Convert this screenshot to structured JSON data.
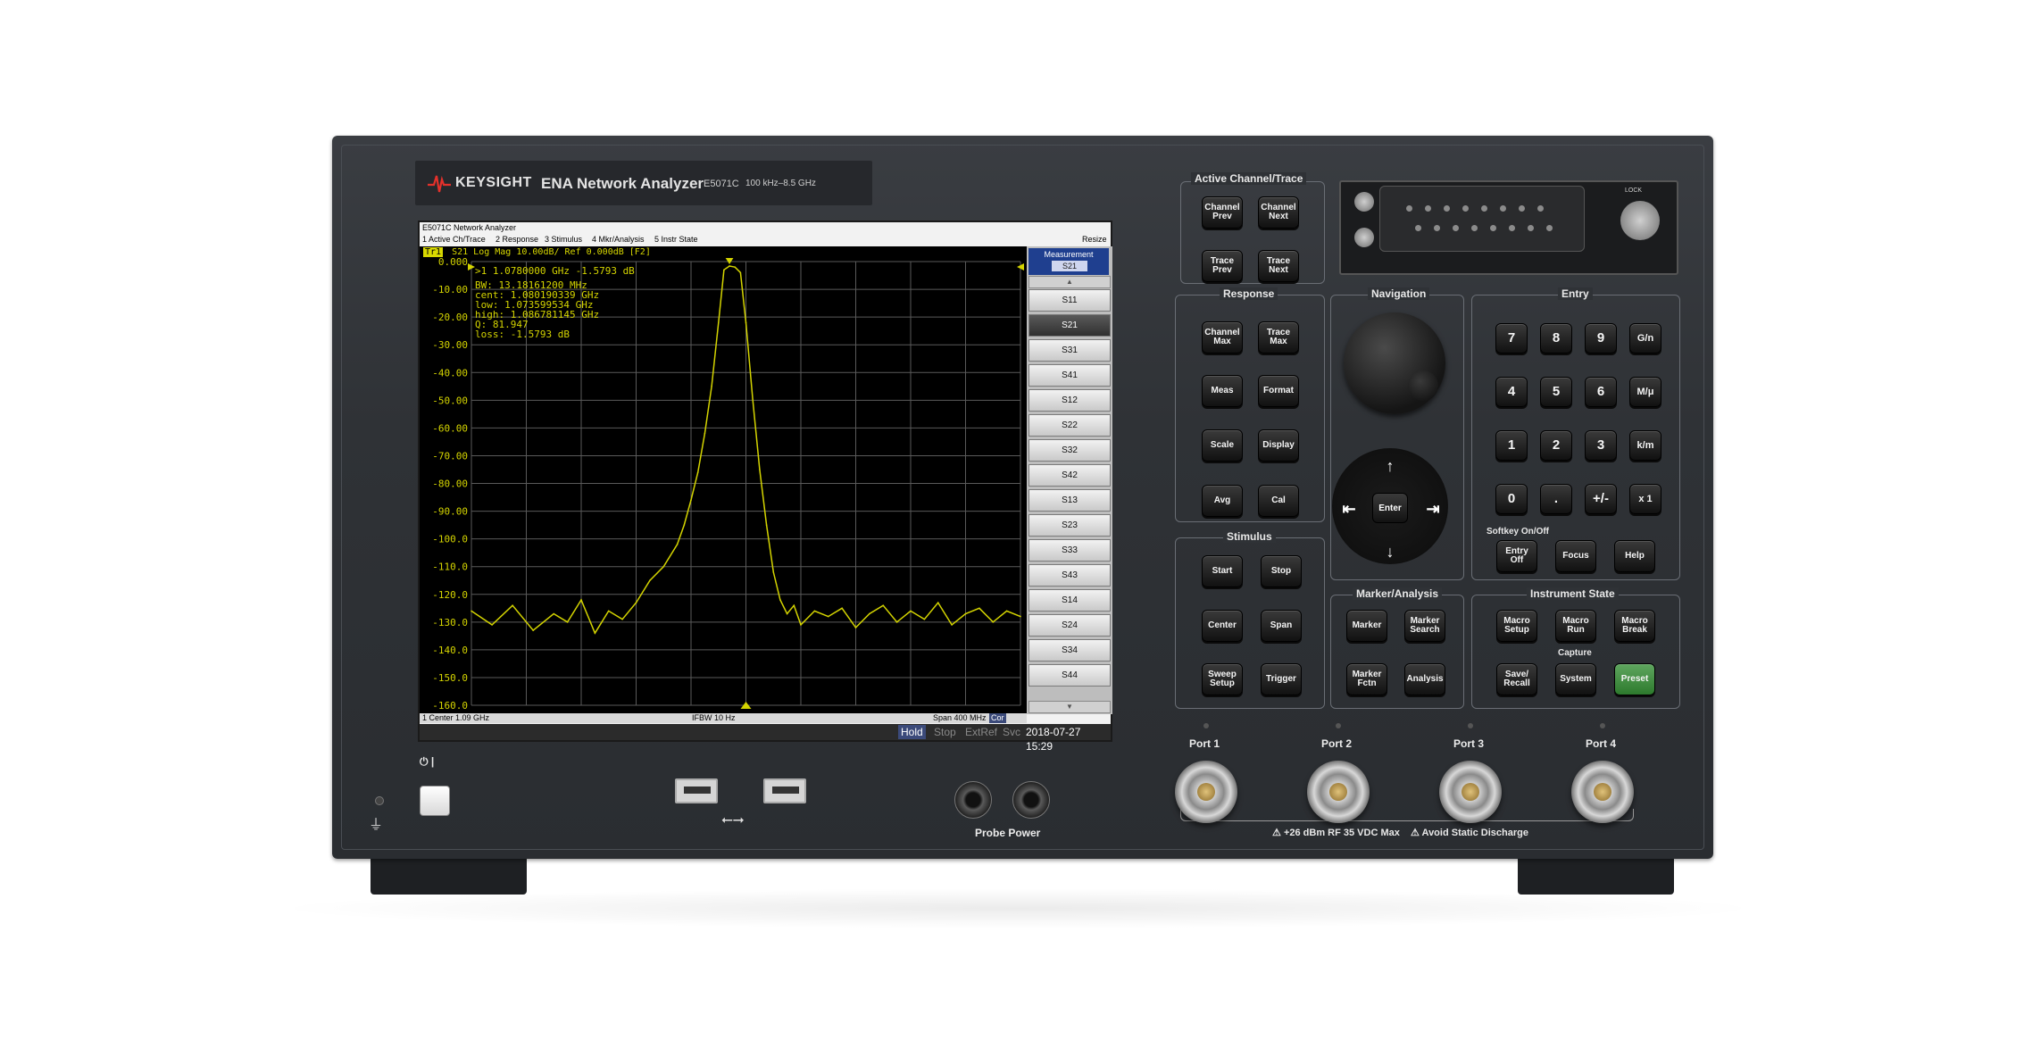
{
  "brand": {
    "name": "KEYSIGHT",
    "model_title": "ENA Network Analyzer",
    "model_number": "E5071C",
    "freq_range": "100 kHz–8.5 GHz"
  },
  "screen": {
    "window_title": "E5071C Network Analyzer",
    "menu": [
      "1 Active Ch/Trace",
      "2 Response",
      "3 Stimulus",
      "4 Mkr/Analysis",
      "5 Instr State"
    ],
    "resize_label": "Resize",
    "trace_badge": "Tr1",
    "trace_header": "S21 Log Mag 10.00dB/ Ref 0.000dB [F2]",
    "marker_readout": ">1  1.0780000 GHz -1.5793 dB",
    "bw_lines": [
      "  BW:  13.18161200 MHz",
      "cent:  1.080190339 GHz",
      " low:  1.073599534 GHz",
      "high:  1.086781145 GHz",
      "   Q:  81.947",
      "loss: -1.5793 dB"
    ],
    "bottom_left": "1  Center 1.09 GHz",
    "bottom_center": "IFBW 10 Hz",
    "bottom_right": "Span 400 MHz",
    "bottom_cor": "Cor",
    "status": {
      "hold": "Hold",
      "stop": "Stop",
      "extref": "ExtRef",
      "svc": "Svc",
      "datetime": "2018-07-27 15:29"
    },
    "softkeys": {
      "title": "Measurement",
      "current": "S21",
      "items": [
        "S11",
        "S21",
        "S31",
        "S41",
        "S12",
        "S22",
        "S32",
        "S42",
        "S13",
        "S23",
        "S33",
        "S43",
        "S14",
        "S24",
        "S34",
        "S44"
      ],
      "active_index": 1
    }
  },
  "chart_data": {
    "type": "line",
    "title": "",
    "xlabel": "",
    "ylabel": "",
    "xlim": [
      0.89,
      1.29
    ],
    "ylim": [
      -160,
      0
    ],
    "ytick_labels": [
      "0.000",
      "-10.00",
      "-20.00",
      "-30.00",
      "-40.00",
      "-50.00",
      "-60.00",
      "-70.00",
      "-80.00",
      "-90.00",
      "-100.0",
      "-110.0",
      "-120.0",
      "-130.0",
      "-140.0",
      "-150.0",
      "-160.0"
    ],
    "series": [
      {
        "x": [
          0.89,
          0.905,
          0.92,
          0.935,
          0.95,
          0.96,
          0.97,
          0.98,
          0.99,
          1.0,
          1.01,
          1.02,
          1.03,
          1.04,
          1.045,
          1.05,
          1.055,
          1.06,
          1.065,
          1.07,
          1.074,
          1.078,
          1.082,
          1.086,
          1.09,
          1.095,
          1.1,
          1.105,
          1.11,
          1.115,
          1.12,
          1.125,
          1.13,
          1.14,
          1.15,
          1.16,
          1.17,
          1.18,
          1.19,
          1.2,
          1.21,
          1.22,
          1.23,
          1.24,
          1.25,
          1.26,
          1.27,
          1.28,
          1.29
        ],
        "y": [
          -126,
          -131,
          -124,
          -133,
          -127,
          -130,
          -122,
          -134,
          -126,
          -129,
          -123,
          -115,
          -110,
          -102,
          -95,
          -86,
          -76,
          -62,
          -45,
          -22,
          -3,
          -1.6,
          -2,
          -4,
          -22,
          -50,
          -75,
          -95,
          -112,
          -122,
          -127,
          -124,
          -131,
          -126,
          -128,
          -125,
          -132,
          -127,
          -124,
          -130,
          -126,
          -129,
          -123,
          -131,
          -127,
          -125,
          -130,
          -126,
          -128
        ]
      }
    ]
  },
  "panel": {
    "active_channel_trace": {
      "label": "Active Channel/Trace",
      "keys": [
        "Channel Prev",
        "Channel Next",
        "Trace Prev",
        "Trace Next"
      ]
    },
    "response": {
      "label": "Response",
      "keys": [
        "Channel Max",
        "Trace Max",
        "Meas",
        "Format",
        "Scale",
        "Display",
        "Avg",
        "Cal"
      ]
    },
    "stimulus": {
      "label": "Stimulus",
      "keys": [
        "Start",
        "Stop",
        "Center",
        "Span",
        "Sweep Setup",
        "Trigger"
      ]
    },
    "navigation": {
      "label": "Navigation",
      "enter": "Enter",
      "arrows": [
        "↑",
        "↓",
        "⇤",
        "⇥"
      ]
    },
    "marker_analysis": {
      "label": "Marker/Analysis",
      "keys": [
        "Marker",
        "Marker Search",
        "Marker Fctn",
        "Analysis"
      ]
    },
    "entry": {
      "label": "Entry",
      "keys": [
        "7",
        "8",
        "9",
        "G/n",
        "4",
        "5",
        "6",
        "M/μ",
        "1",
        "2",
        "3",
        "k/m",
        "0",
        ".",
        "+/-",
        "x 1"
      ],
      "softkey_caption": "Softkey On/Off",
      "bottom_keys": [
        "Entry Off",
        "Focus",
        "Help"
      ]
    },
    "instrument_state": {
      "label": "Instrument State",
      "keys": [
        "Macro Setup",
        "Macro Run",
        "Macro Break"
      ],
      "capture_caption": "Capture",
      "bottom_keys": [
        "Save/ Recall",
        "System",
        "Preset"
      ]
    }
  },
  "ports": [
    "Port 1",
    "Port 2",
    "Port 3",
    "Port 4"
  ],
  "port_warning": "+26 dBm RF  35 VDC Max",
  "esd_warning": "Avoid Static Discharge",
  "probe_power_label": "Probe Power",
  "lock_label": "LOCK",
  "power_symbols": "⏻ |",
  "usb_symbol": "⭠⭢",
  "colors": {
    "trace": "#d4d400",
    "plot_bg": "#000000",
    "grid": "#5a5a5a",
    "preset_key": "#3e8f3e",
    "softkey_header": "#1f3f8f"
  }
}
